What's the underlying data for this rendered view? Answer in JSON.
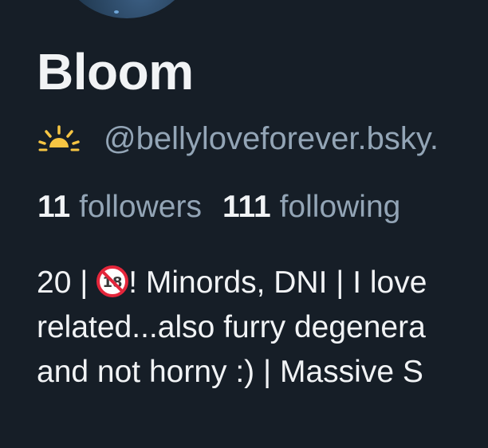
{
  "profile": {
    "display_name": "Bloom",
    "handle_icon": "sunrise-icon",
    "handle": "@bellyloveforever.bsky.",
    "followers_count": "11",
    "followers_label": "followers",
    "following_count": "111",
    "following_label": "following",
    "bio": {
      "line1_before_icon": "20 | ",
      "line1_icon": "no-under-18-icon",
      "line1_after_icon": "! Minords, DNI | I love",
      "line2": "related...also furry degenera",
      "line3": "and not horny :) | Massive S"
    }
  },
  "colors": {
    "background": "#161e27",
    "text_primary": "#f1f3f5",
    "text_secondary": "#93a5b6",
    "sun_yellow": "#f6c543"
  }
}
